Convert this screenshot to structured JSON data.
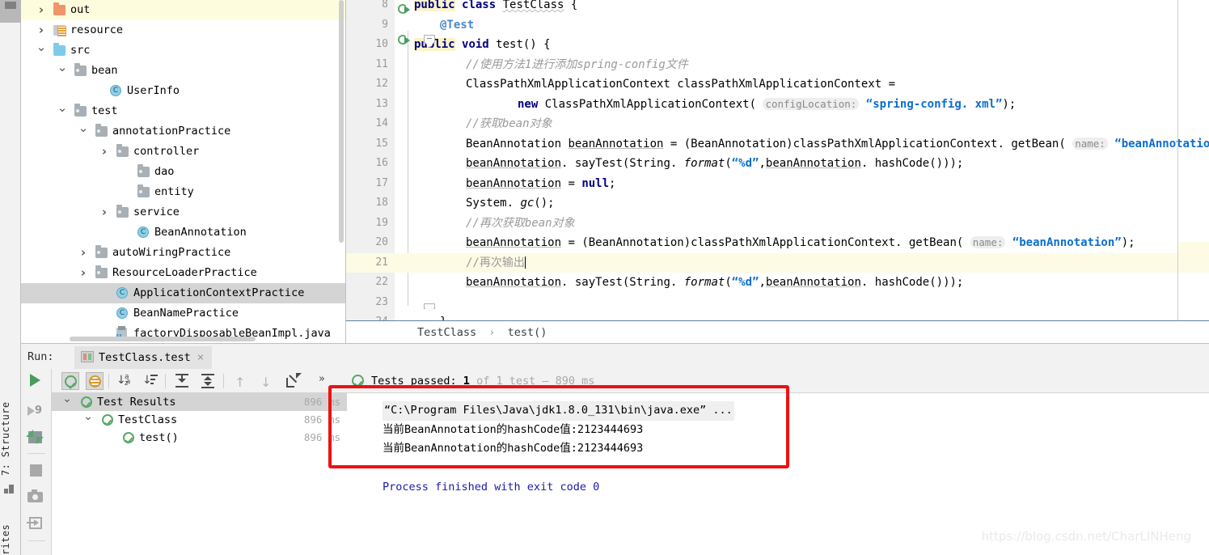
{
  "vertical_strip": {
    "structure_tab": "7: Structure",
    "favorites_tab": "rites",
    "structure_icon": "structure-icon"
  },
  "project_tree": {
    "items": [
      {
        "label": "out",
        "indent": 40,
        "twist": "closed",
        "icon": "folder-orange",
        "state": "highlighted"
      },
      {
        "label": "resource",
        "indent": 40,
        "twist": "closed",
        "icon": "folder-resource",
        "state": "normal"
      },
      {
        "label": "src",
        "indent": 40,
        "twist": "open",
        "icon": "folder-blue",
        "state": "normal"
      },
      {
        "label": "bean",
        "indent": 66,
        "twist": "open",
        "icon": "folder-gray",
        "state": "normal"
      },
      {
        "label": "UserInfo",
        "indent": 110,
        "twist": "none",
        "icon": "class",
        "state": "normal"
      },
      {
        "label": "test",
        "indent": 66,
        "twist": "open",
        "icon": "folder-gray",
        "state": "normal"
      },
      {
        "label": "annotationPractice",
        "indent": 92,
        "twist": "open",
        "icon": "folder-gray",
        "state": "normal"
      },
      {
        "label": "controller",
        "indent": 118,
        "twist": "closed",
        "icon": "folder-gray",
        "state": "normal"
      },
      {
        "label": "dao",
        "indent": 144,
        "twist": "none",
        "icon": "folder-gray",
        "state": "normal"
      },
      {
        "label": "entity",
        "indent": 144,
        "twist": "none",
        "icon": "folder-gray",
        "state": "normal"
      },
      {
        "label": "service",
        "indent": 118,
        "twist": "closed",
        "icon": "folder-gray",
        "state": "normal"
      },
      {
        "label": "BeanAnnotation",
        "indent": 144,
        "twist": "none",
        "icon": "class",
        "state": "normal"
      },
      {
        "label": "autoWiringPractice",
        "indent": 92,
        "twist": "closed",
        "icon": "folder-gray",
        "state": "normal"
      },
      {
        "label": "ResourceLoaderPractice",
        "indent": 92,
        "twist": "closed",
        "icon": "folder-gray",
        "state": "normal"
      },
      {
        "label": "ApplicationContextPractice",
        "indent": 118,
        "twist": "none",
        "icon": "class",
        "state": "selected"
      },
      {
        "label": "BeanNamePractice",
        "indent": 118,
        "twist": "none",
        "icon": "class",
        "state": "normal"
      },
      {
        "label": "factoryDisposableBeanImpl.java",
        "indent": 118,
        "twist": "none",
        "icon": "java-file",
        "state": "normal"
      }
    ]
  },
  "editor": {
    "lines": [
      {
        "num": "8",
        "highlight": false,
        "gutter_run": true,
        "fold": false
      },
      {
        "num": "9",
        "highlight": false,
        "gutter_run": false,
        "fold": false
      },
      {
        "num": "10",
        "highlight": false,
        "gutter_run": true,
        "fold": true
      },
      {
        "num": "11",
        "highlight": false,
        "gutter_run": false,
        "fold": false
      },
      {
        "num": "12",
        "highlight": false,
        "gutter_run": false,
        "fold": false
      },
      {
        "num": "13",
        "highlight": false,
        "gutter_run": false,
        "fold": false
      },
      {
        "num": "14",
        "highlight": false,
        "gutter_run": false,
        "fold": false
      },
      {
        "num": "15",
        "highlight": false,
        "gutter_run": false,
        "fold": false
      },
      {
        "num": "16",
        "highlight": false,
        "gutter_run": false,
        "fold": false
      },
      {
        "num": "17",
        "highlight": false,
        "gutter_run": false,
        "fold": false
      },
      {
        "num": "18",
        "highlight": false,
        "gutter_run": false,
        "fold": false
      },
      {
        "num": "19",
        "highlight": false,
        "gutter_run": false,
        "fold": false
      },
      {
        "num": "20",
        "highlight": false,
        "gutter_run": false,
        "fold": false
      },
      {
        "num": "21",
        "highlight": true,
        "gutter_run": false,
        "fold": false
      },
      {
        "num": "22",
        "highlight": false,
        "gutter_run": false,
        "fold": false
      },
      {
        "num": "23",
        "highlight": false,
        "gutter_run": false,
        "fold": false
      },
      {
        "num": "24",
        "highlight": false,
        "gutter_run": false,
        "fold": true
      }
    ],
    "code": {
      "l8_public": "public",
      "l8_class": "class",
      "l8_name": "TestClass",
      "l8_brace": "{",
      "l9_test": "@Test",
      "l10_public": "public",
      "l10_void": "void",
      "l10_rest": "test() {",
      "l11_comment": "//使用方法1进行添加spring-config文件",
      "l12": "ClassPathXmlApplicationContext classPathXmlApplicationContext =",
      "l13_new": "new",
      "l13_ctor": "ClassPathXmlApplicationContext(",
      "l13_hint": "configLocation:",
      "l13_str": "“spring-config. xml”",
      "l13_tail": ");",
      "l14_comment": "//获取bean对象",
      "l15_a": "BeanAnnotation ",
      "l15_var": "beanAnnotation",
      "l15_b": " = (BeanAnnotation)classPathXmlApplicationContext. getBean(",
      "l15_hint": "name:",
      "l15_str": "“beanAnnotation”",
      "l15_tail": ");",
      "l16_var": "beanAnnotation",
      "l16_a": ". sayTest(String. ",
      "l16_fmt": "format",
      "l16_b": "(",
      "l16_str": "“%d”",
      "l16_c": ",",
      "l16_var2": "beanAnnotation",
      "l16_d": ". hashCode()));",
      "l17_var": "beanAnnotation",
      "l17_eq": " = ",
      "l17_null": "null",
      "l17_semi": ";",
      "l18_a": "System. ",
      "l18_gc": "gc",
      "l18_b": "();",
      "l19_comment": "//再次获取bean对象",
      "l20_var": "beanAnnotation",
      "l20_a": " = (BeanAnnotation)classPathXmlApplicationContext. getBean(",
      "l20_hint": "name:",
      "l20_str": "“beanAnnotation”",
      "l20_tail": ");",
      "l21_comment": "//再次输出",
      "l22_var": "beanAnnotation",
      "l22_a": ". sayTest(String. ",
      "l22_fmt": "format",
      "l22_b": "(",
      "l22_str": "“%d”",
      "l22_c": ",",
      "l22_var2": "beanAnnotation",
      "l22_d": ". hashCode()));",
      "l24_brace": "}"
    }
  },
  "breadcrumb": {
    "class": "TestClass",
    "separator": "›",
    "method": "test()"
  },
  "run_panel": {
    "run_label": "Run:",
    "tab_title": "TestClass.test",
    "tab_close": "×",
    "toolbar": {
      "show_passed": "show-passed-toggle",
      "show_ignored": "show-ignored-toggle",
      "sort_alpha": "sort-alphabetically-icon",
      "sort_duration": "sort-by-duration-icon",
      "expand_all": "expand-all-icon",
      "collapse_all": "collapse-all-icon",
      "prev_test": "previous-failed-test-icon",
      "next_test": "next-failed-test-icon",
      "export": "export-test-results-icon",
      "overflow": "»"
    },
    "sidebar_icons": [
      "rerun-failed-tests-icon",
      "rerun-tests-icon",
      "stop-icon",
      "snapshot-icon",
      "export-to-file-icon"
    ],
    "tests_header": {
      "prefix": "Tests passed: ",
      "count": "1",
      "suffix": " of 1 test – 890 ms"
    },
    "test_tree": [
      {
        "label": "Test Results",
        "ms": "896 ms",
        "indent": 36,
        "twist": true,
        "state": "selected"
      },
      {
        "label": "TestClass",
        "ms": "896 ms",
        "indent": 62,
        "twist": true,
        "state": "normal"
      },
      {
        "label": "test()",
        "ms": "896 ms",
        "indent": 88,
        "twist": false,
        "state": "normal"
      }
    ],
    "console": {
      "command": "“C:\\Program Files\\Java\\jdk1.8.0_131\\bin\\java.exe” ...",
      "line1": "当前BeanAnnotation的hashCode值:2123444693",
      "line2": "当前BeanAnnotation的hashCode值:2123444693",
      "exit": "Process finished with exit code 0"
    }
  },
  "annotation": {
    "box_color": "#ee1111"
  },
  "watermark": "https://blog.csdn.net/CharLINHeng"
}
